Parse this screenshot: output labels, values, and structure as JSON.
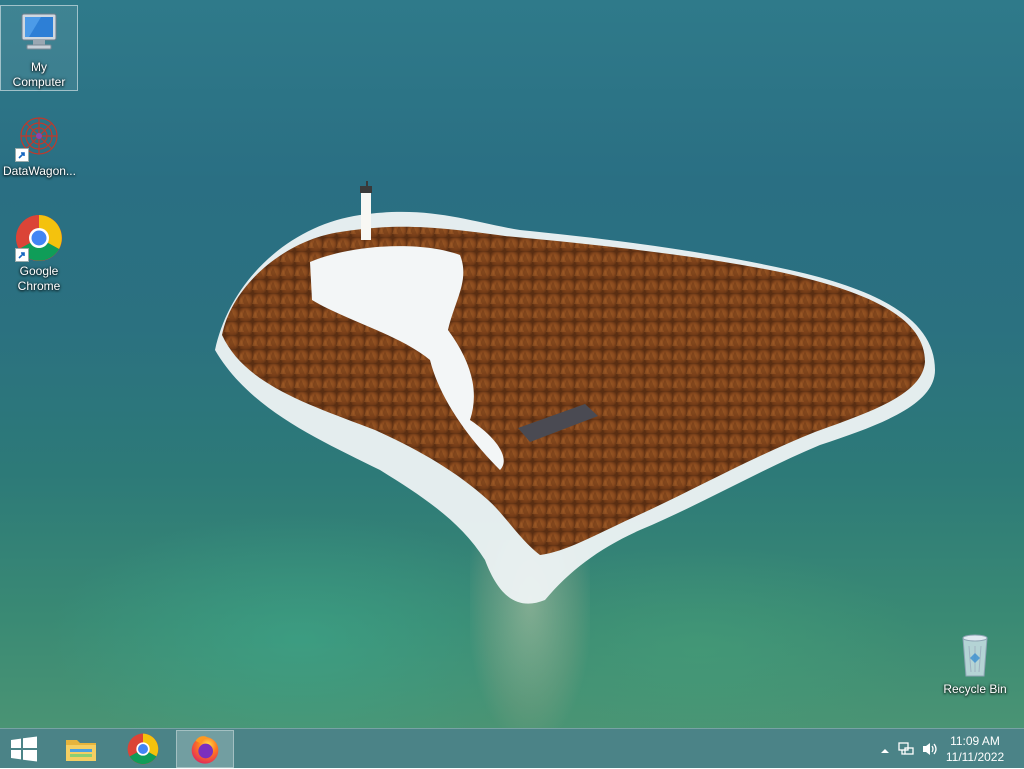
{
  "desktop": {
    "icons": [
      {
        "label": "My Computer",
        "icon": "my-computer-icon"
      },
      {
        "label": "DataWagon...",
        "icon": "datawagon-icon"
      },
      {
        "label": "Google Chrome",
        "icon": "chrome-icon"
      },
      {
        "label": "Recycle Bin",
        "icon": "recycle-bin-icon"
      }
    ]
  },
  "taskbar": {
    "pinned": [
      {
        "icon": "start-windows-icon"
      },
      {
        "icon": "file-explorer-icon"
      },
      {
        "icon": "chrome-icon"
      },
      {
        "icon": "firefox-icon",
        "active": true
      }
    ],
    "tray": {
      "icons": [
        "show-hidden-icons-chevron",
        "network-icon",
        "volume-icon"
      ],
      "time": "11:09 AM",
      "date": "11/11/2022"
    }
  },
  "colors": {
    "taskbar": "#3c787d",
    "water": "#2b7180",
    "trees": "#8a4a1e"
  }
}
